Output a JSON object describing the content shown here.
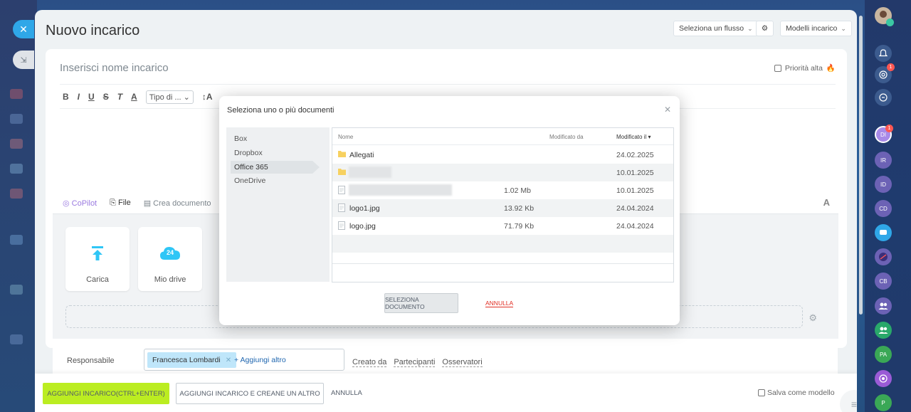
{
  "header": {
    "title": "Nuovo incarico",
    "flow_select": "Seleziona un flusso",
    "templates_button": "Modelli incarico"
  },
  "task": {
    "name_placeholder": "Inserisci nome incarico",
    "high_priority": "Priorità alta",
    "type_select": "Tipo di ..."
  },
  "attachments": {
    "tabs": [
      "CoPilot",
      "File",
      "Crea documento"
    ],
    "tiles": [
      "Carica",
      "Mio drive"
    ],
    "drive_badge": "24"
  },
  "responsible": {
    "label": "Responsabile",
    "chip": "Francesca Lombardi",
    "add_more": "+ Aggiungi altro",
    "links": [
      "Creato da",
      "Partecipanti",
      "Osservatori"
    ]
  },
  "footer": {
    "add_task": "AGGIUNGI INCARICO(CTRL+ENTER)",
    "add_and_create": "AGGIUNGI INCARICO E CREANE UN ALTRO",
    "cancel": "ANNULLA",
    "save_as_template": "Salva come modello"
  },
  "modal": {
    "title": "Seleziona uno o più documenti",
    "sources": [
      "Box",
      "Dropbox",
      "Office 365",
      "OneDrive"
    ],
    "active_source": "Office 365",
    "columns": {
      "name": "Nome",
      "modified_by": "Modificato da",
      "modified_on": "Modificato il ▾"
    },
    "files": [
      {
        "name": "Allegati",
        "size": "",
        "date": "24.02.2025",
        "type": "folder"
      },
      {
        "name": "",
        "size": "",
        "date": "10.01.2025",
        "type": "folder"
      },
      {
        "name": "",
        "size": "1.02 Mb",
        "date": "10.01.2025",
        "type": "file"
      },
      {
        "name": "logo1.jpg",
        "size": "13.92 Kb",
        "date": "24.04.2024",
        "type": "file"
      },
      {
        "name": "logo.jpg",
        "size": "71.79 Kb",
        "date": "24.04.2024",
        "type": "file"
      }
    ],
    "select_button": "SELEZIONA DOCUMENTO",
    "cancel_button": "ANNULLA"
  },
  "right_bar": {
    "badges": [
      "1",
      "1"
    ],
    "avatars": [
      "DI",
      "IR",
      "ID",
      "CD",
      "CB",
      "PA",
      "P"
    ]
  }
}
